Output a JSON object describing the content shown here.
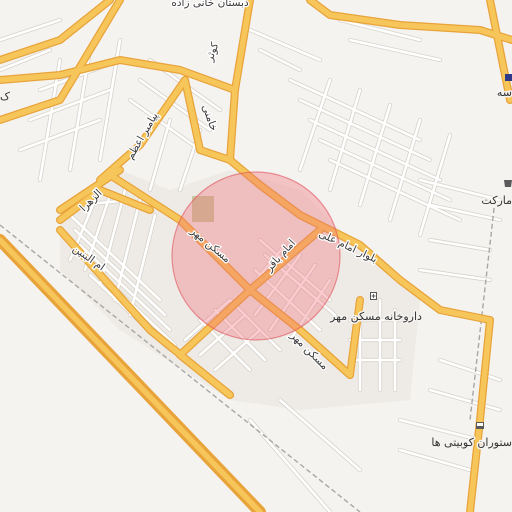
{
  "map": {
    "colors": {
      "background": "#f5f3f0",
      "major_road": "#f7c65a",
      "major_road_casing": "#e8a33a",
      "minor_road": "#ffffff",
      "minor_road_casing": "#d7d3cc",
      "railway": "#a7a7a7",
      "district_fill": "#e7e4df",
      "park": "#c9c9a0",
      "highlight_fill": "#f06a74",
      "highlight_stroke": "#e0535e"
    },
    "highlight_circle": {
      "label": "search-area"
    },
    "street_labels": {
      "kowsar": "کوثر",
      "khamenei": "خامنی",
      "payambar_azam": "پیامبر اعظم",
      "alzahra": "الزهرا",
      "ommolbanin": "ام البنین",
      "maskan_mehr_1": "مسکن مهر",
      "maskan_mehr_2": "مسکن مهر",
      "imam_bagher": "امام باقر",
      "imam_ali_blvd": "بلوار امام علی",
      "top_street": "دبستان خانی زاده"
    },
    "poi": [
      {
        "name": "داروخانه مسکن مهر",
        "icon": "pharmacy-icon"
      },
      {
        "name": "مارکت",
        "icon": "shop-icon"
      },
      {
        "name": "سه",
        "icon": "school-icon"
      },
      {
        "name": "ستوران کوبیتی ها",
        "icon": "restaurant-icon"
      },
      {
        "name": "ک",
        "icon": ""
      }
    ]
  }
}
